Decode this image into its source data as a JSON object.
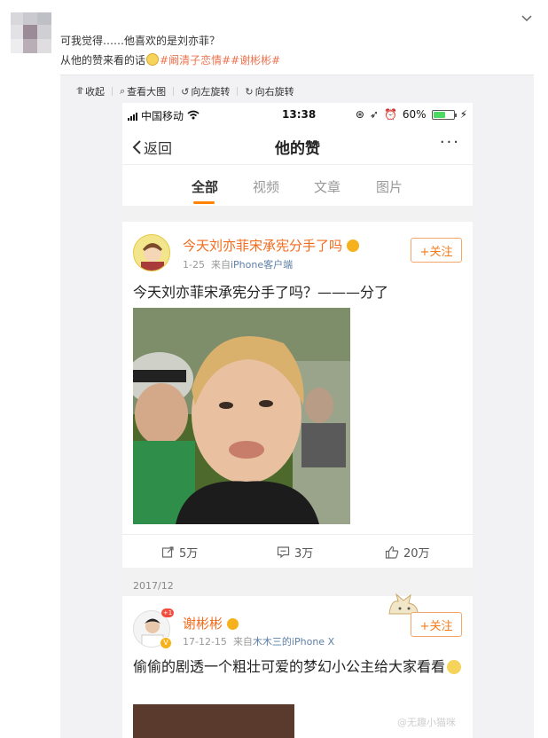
{
  "comment": {
    "line1": "可我觉得……他喜欢的是刘亦菲？",
    "line2_prefix": "从他的赞来看的话",
    "line2_topics": "#阚清子恋情##谢彬彬#"
  },
  "toolbar": {
    "collapse": "收起",
    "view_large": "查看大图",
    "rotate_left": "向左旋转",
    "rotate_right": "向右旋转"
  },
  "phone": {
    "carrier": "中国移动",
    "time": "13:38",
    "battery": "60%",
    "back": "返回",
    "title": "他的赞",
    "more": "···",
    "tabs": [
      "全部",
      "视频",
      "文章",
      "图片"
    ],
    "active_tab": "全部",
    "post1": {
      "name": "今天刘亦菲宋承宪分手了吗",
      "date": "1-25",
      "from_prefix": "来自",
      "source": "iPhone客户端",
      "follow": "+关注",
      "text": "今天刘亦菲宋承宪分手了吗？———分了",
      "repost_count": "5万",
      "comment_count": "3万",
      "like_count": "20万"
    },
    "date_separator": "2017/12",
    "post2": {
      "name": "谢彬彬",
      "date": "17-12-15",
      "from_prefix": "来自",
      "source": "木木三的iPhone X",
      "follow": "+关注",
      "text": "偷偷的剧透一个粗壮可爱的梦幻小公主给大家看看",
      "badge": "+1"
    }
  },
  "watermark": "@无趣小猫咪",
  "colors": {
    "accent_orange": "#ff8200",
    "name_orange": "#f36b1c",
    "topic_color": "#eb7350",
    "link_blue": "#5d7fa6"
  }
}
